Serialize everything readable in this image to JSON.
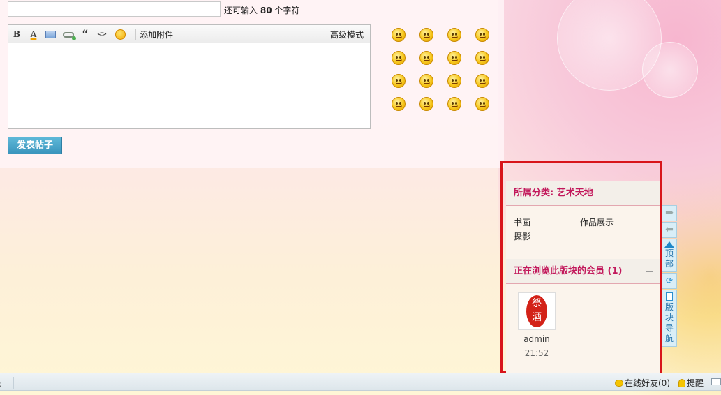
{
  "reply": {
    "title_placeholder": "",
    "char_hint_prefix": "还可输入",
    "char_count": "80",
    "char_hint_suffix": "个字符",
    "toolbar": {
      "bold": "B",
      "color": "A",
      "quote": "“",
      "code": "<>",
      "attach_label": "添加附件",
      "advanced_label": "高级模式"
    },
    "submit_label": "发表帖子"
  },
  "smilies": [
    "smile",
    "sad",
    "grin",
    "cry",
    "angry",
    "shy",
    "wink",
    "love",
    "laugh",
    "squint",
    "grimace",
    "lol",
    "blush",
    "sick",
    "faint",
    "annoyed"
  ],
  "category": {
    "header": "所属分类: 艺术天地",
    "items": [
      "书画",
      "作品展示",
      "摄影"
    ]
  },
  "browsing": {
    "header": "正在浏览此版块的会员 (1)",
    "members": [
      {
        "name": "admin",
        "time": "21:52",
        "avatar_text": [
          "祭",
          "酒"
        ]
      }
    ]
  },
  "side_nav": {
    "top_label": "顶部",
    "forum_nav_label": "版块导航"
  },
  "bottom_bar": {
    "login_stub": "录",
    "online_friends": "在线好友(0)",
    "remind": "提醒"
  },
  "colors": {
    "accent": "#c2185b",
    "button": "#3a95bd",
    "highlight_border": "#d8151b"
  }
}
